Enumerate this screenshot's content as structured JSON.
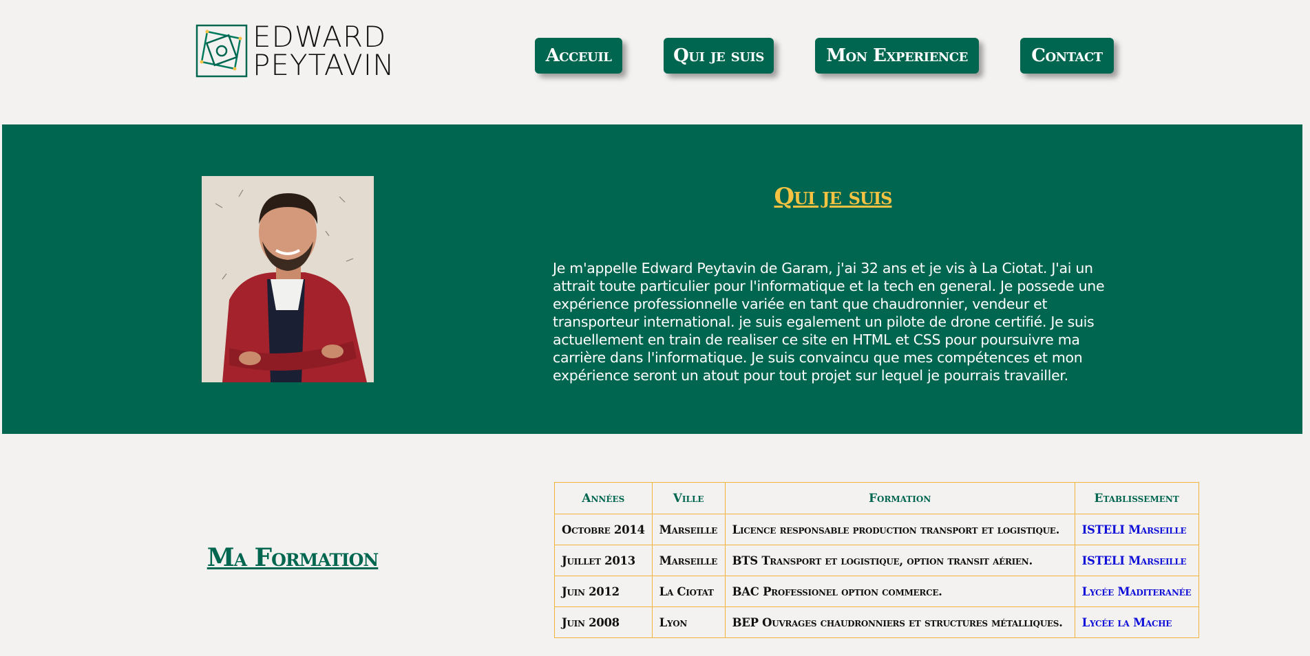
{
  "header": {
    "logo_line1": "EDWARD",
    "logo_line2": "PEYTAVIN",
    "nav": [
      {
        "label": "Acceuil"
      },
      {
        "label": "Qui je suis"
      },
      {
        "label": "Mon Experience"
      },
      {
        "label": "Contact"
      }
    ]
  },
  "about": {
    "title": "Qui je suis",
    "photo": "portrait-photo",
    "text": "Je m'appelle Edward Peytavin de Garam, j'ai 32 ans et je vis à La Ciotat. J'ai un attrait toute particulier pour l'informatique et la tech en general. Je possede une expérience professionnelle variée en tant que chaudronnier, vendeur et transporteur international. je suis egalement un pilote de drone certifié. Je suis actuellement en train de realiser ce site en HTML et CSS pour poursuivre ma carrière dans l'informatique. Je suis convaincu que mes compétences et mon expérience seront un atout pour tout projet sur lequel je pourrais travailler."
  },
  "formation": {
    "title": "Ma Formation",
    "headers": [
      "Années",
      "Ville",
      "Formation",
      "Etablissement"
    ],
    "rows": [
      [
        "Octobre 2014",
        "Marseille",
        "Licence responsable production transport et logistique.",
        "ISTELI Marseille"
      ],
      [
        "Juillet 2013",
        "Marseille",
        "BTS Transport et logistique, option transit aérien.",
        "ISTELI Marseille"
      ],
      [
        "Juin 2012",
        "La Ciotat",
        "BAC Professionel option commerce.",
        "Lycée Maditeranée"
      ],
      [
        "Juin 2008",
        "Lyon",
        "BEP Ouvrages chaudronniers et structures métalliques.",
        "Lycée la Mache"
      ]
    ]
  },
  "colors": {
    "brand_green": "#006650",
    "accent_yellow": "#f5c242",
    "table_border": "#f0b43c",
    "link_blue": "#1010d8",
    "background": "#f3f2f0"
  }
}
